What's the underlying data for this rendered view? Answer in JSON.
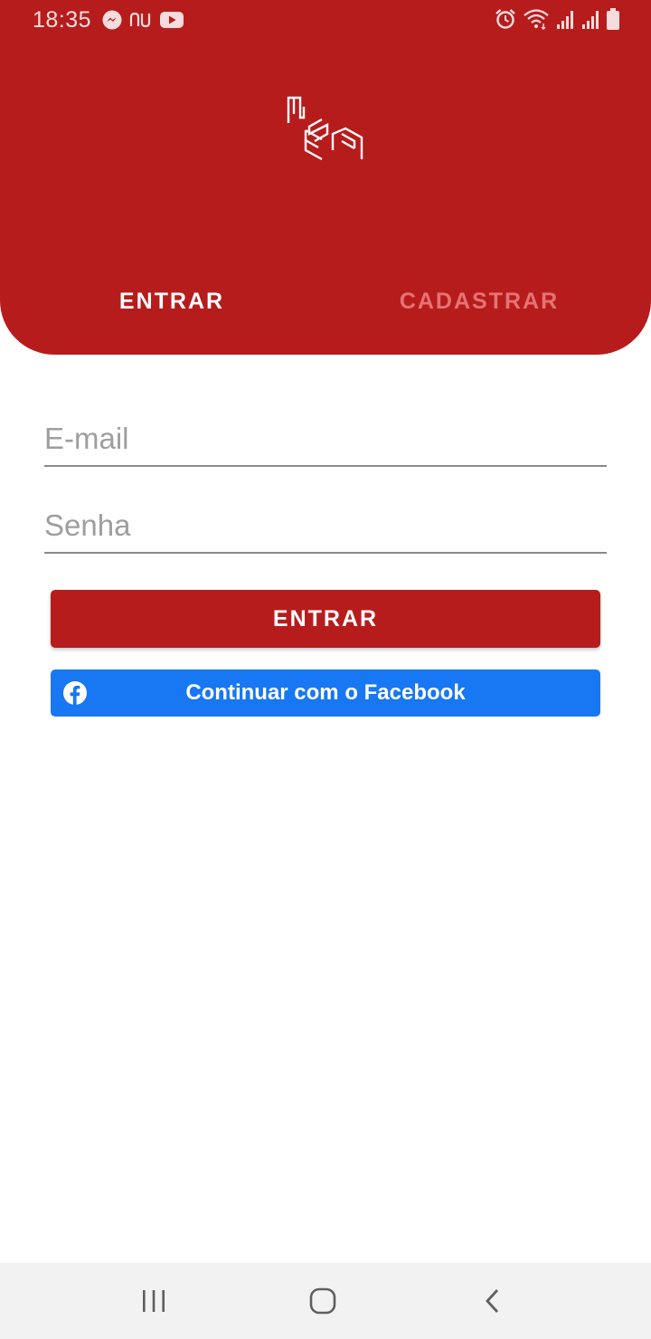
{
  "status_bar": {
    "time": "18:35",
    "left_icons": [
      "messenger-icon",
      "nubank-icon",
      "youtube-icon"
    ],
    "right_icons": [
      "alarm-icon",
      "wifi-icon",
      "signal-icon",
      "signal-icon",
      "battery-icon"
    ]
  },
  "header": {
    "logo": "mesa-logo",
    "tabs": [
      {
        "label": "ENTRAR",
        "active": true
      },
      {
        "label": "CADASTRAR",
        "active": false
      }
    ]
  },
  "form": {
    "email_placeholder": "E-mail",
    "email_value": "",
    "password_placeholder": "Senha",
    "password_value": "",
    "login_button_label": "ENTRAR",
    "facebook_button_label": "Continuar com o Facebook"
  },
  "nav_bar": {
    "buttons": [
      "recents-icon",
      "home-icon",
      "back-icon"
    ]
  },
  "colors": {
    "primary": "#b71c1c",
    "inactive_tab": "#e57373",
    "facebook": "#1877f2",
    "nav_background": "#f2f2f2"
  }
}
